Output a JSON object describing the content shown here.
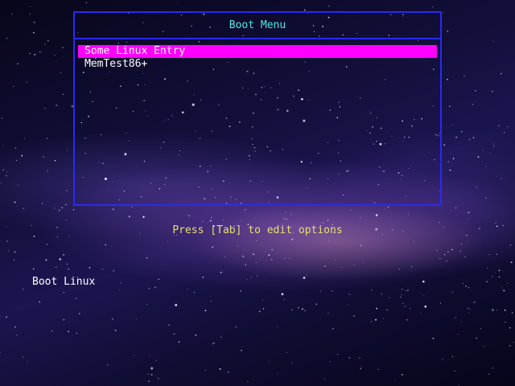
{
  "menu": {
    "title": "Boot Menu",
    "items": [
      {
        "label": "Some Linux Entry",
        "selected": true
      },
      {
        "label": "MemTest86+",
        "selected": false
      }
    ]
  },
  "hint": "Press [Tab] to edit options",
  "status_label": "Boot Linux",
  "colors": {
    "border": "#2a2af0",
    "title": "#4fe8e8",
    "selection": "#ff00ff",
    "hint": "#e3e070",
    "text": "#ffffff"
  }
}
